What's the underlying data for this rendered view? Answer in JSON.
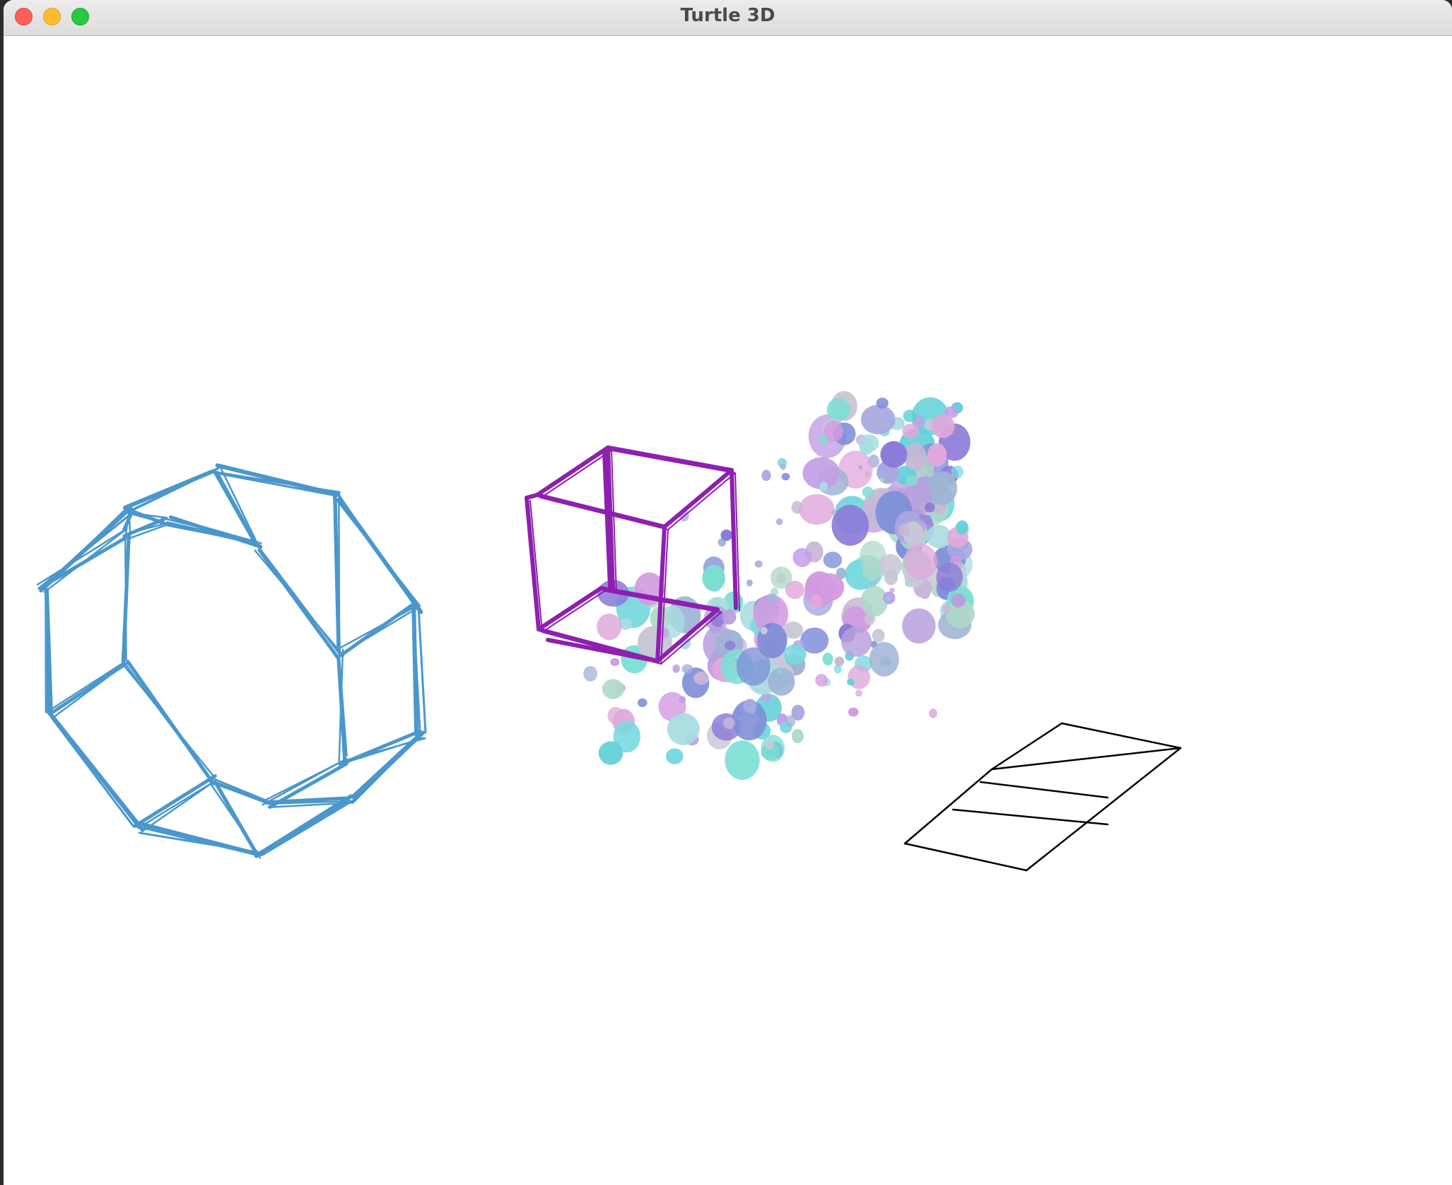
{
  "window": {
    "title": "Turtle 3D"
  },
  "colors": {
    "polyhedron": "#4a97cc",
    "cube": "#8e1fb0",
    "plane": "#000000",
    "dots": [
      "#7f8fd8",
      "#7ddfd3",
      "#b8a0dc",
      "#d49be0",
      "#9fb4d6",
      "#a9dce0",
      "#c8b7d6",
      "#79d9e0",
      "#8b7bd8",
      "#c9c9d6",
      "#b0d8c8",
      "#e0a8dc",
      "#5fd0d8",
      "#a8a8e0",
      "#c39fe6"
    ]
  },
  "icons": {
    "close": "close-icon",
    "minimize": "minimize-icon",
    "maximize": "maximize-icon"
  }
}
